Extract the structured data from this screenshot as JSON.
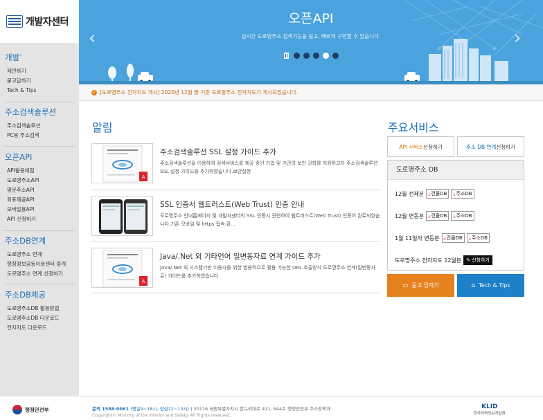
{
  "brand": {
    "title": "개발자센터"
  },
  "sidebar": {
    "groups": [
      {
        "title": "개발",
        "items": [
          "제안하기",
          "묻고답하기",
          "Tech & Tips"
        ]
      },
      {
        "title": "주소검색솔루션",
        "items": [
          "주소검색솔루션",
          "PC용 주소검색"
        ]
      },
      {
        "title": "오픈API",
        "items": [
          "API활용체험",
          "도로명주소API",
          "영문주소API",
          "좌표제공API",
          "모바일용API",
          "API 신청하기"
        ]
      },
      {
        "title": "주소DB연계",
        "items": [
          "도로명주소 연계",
          "행정정보공동이용센터 중계",
          "도로명주소 연계 신청하기"
        ]
      },
      {
        "title": "주소DB제공",
        "items": [
          "도로명주소DB 활용방법",
          "도로명주소DB 다운로드",
          "전자지도 다운로드"
        ]
      }
    ]
  },
  "hero": {
    "title": "오픈API",
    "subtitle": "실시간 도로명주소 검색기능을 쉽고, 빠르게 구현할 수 있습니다.",
    "slides": 5,
    "active_slide": 3
  },
  "notice_bar": {
    "text": "[도로명주소 전자지도 게시] 2020년 12월 말 기준 도로명주소 전자지도가 게시되었습니다."
  },
  "news": {
    "title": "알림",
    "items": [
      {
        "title": "주소검색솔루션 SSL 설정 가이드 추가",
        "desc": "주소검색솔루션을 이용하여 검색서비스를 제공 중인 기업 및 기관의 보안 강화를 지원하고자 주소검색솔루션 SSL 설정 가이드를 추가하였습니다.보안설정"
      },
      {
        "title": "SSL 인증서 웹트러스트(Web Trust) 인증 안내",
        "desc": "도로명주소 안내홈페이지 및 개발자센터의 SSL 인증서 관련하여 웹트러스트(Web Trust) 인증이 완료되었습니다.기존 모바일 및 https 접속 환..."
      },
      {
        "title": "Java/.Net 외 기타언어 일변동자료 연계 가이드 추가",
        "desc": "Java/.Net 외 시스템기반 이용자를 위한 범용적으로 활용 가능한 URL 호출방식 도로명주소 연계(일변동자료) 가이드를 추가하였습니다."
      }
    ]
  },
  "services": {
    "title": "주요서비스",
    "tabs": [
      {
        "highlight": "API 서비스",
        "rest": " 신청하기"
      },
      {
        "highlight": "주소 DB 연계",
        "rest": " 신청하기"
      }
    ],
    "db_title": "도로명주소 DB",
    "rows": [
      {
        "label": "12월 전체분",
        "b1": "건물DB",
        "b2": "주소DB"
      },
      {
        "label": "12월 변동분",
        "b1": "건물DB",
        "b2": "주소DB"
      },
      {
        "label": "1월 11일자 변동분",
        "b1": "건물DB",
        "b2": "주소DB"
      }
    ],
    "map_row": {
      "label": "도로명주소 전자지도 12월분",
      "button": "신청하기"
    },
    "qa_button": "묻고 답하기",
    "tips_button": "Tech & Tips"
  },
  "footer": {
    "ministry": "행정안전부",
    "tel": "문의 1588-0061",
    "hours": "(평일9~18시, 점심12~13시)",
    "address": "30116 세종특별자치시 한누리대로 411, 644호 행정안전부 주소정책과",
    "copyright": "Copyright© Ministry of the Interior and Safety. All Rights reserved.",
    "klid": "KLID",
    "klid_sub": "한국지역정보개발원"
  },
  "colors": {
    "primary": "#1d6fb5",
    "hero": "#4aa3dd",
    "orange": "#e5821d",
    "blue_btn": "#1d80c8"
  }
}
